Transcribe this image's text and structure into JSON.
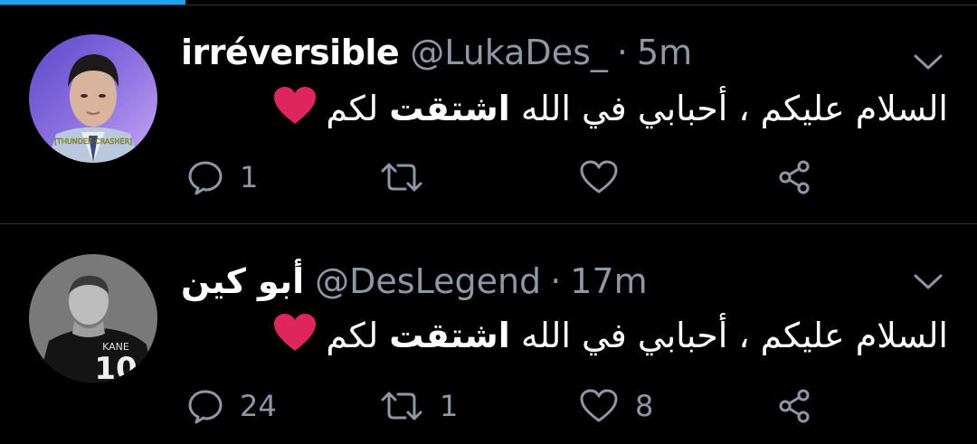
{
  "progress": {
    "fraction": 0.19
  },
  "tweets": [
    {
      "display_name": "irréversible",
      "handle": "@LukaDes_",
      "separator": "·",
      "time": "5m",
      "text": "السلام عليكم ، أحبابي في الله ",
      "text_bold": "اشتقت",
      "text_end": " لكم",
      "emoji": "red-heart",
      "avatar_caption": "[THUNDER CRASHER]",
      "reply_count": "1",
      "retweet_count": "",
      "like_count": ""
    },
    {
      "display_name": "أبو كين",
      "handle": "@DesLegend",
      "separator": "·",
      "time": "17m",
      "text": "السلام عليكم ، أحبابي في الله ",
      "text_bold": "اشتقت",
      "text_end": " لكم",
      "emoji": "red-heart",
      "avatar_jersey_name": "KANE",
      "avatar_jersey_number": "10",
      "reply_count": "24",
      "retweet_count": "1",
      "like_count": "8"
    }
  ],
  "colors": {
    "background": "#000000",
    "secondary_text": "#8b98a5",
    "divider": "#2f3336",
    "accent": "#1da1f2",
    "heart": "#e0245e"
  },
  "icons": [
    "chevron-down-icon",
    "reply-icon",
    "retweet-icon",
    "like-icon",
    "share-icon"
  ]
}
